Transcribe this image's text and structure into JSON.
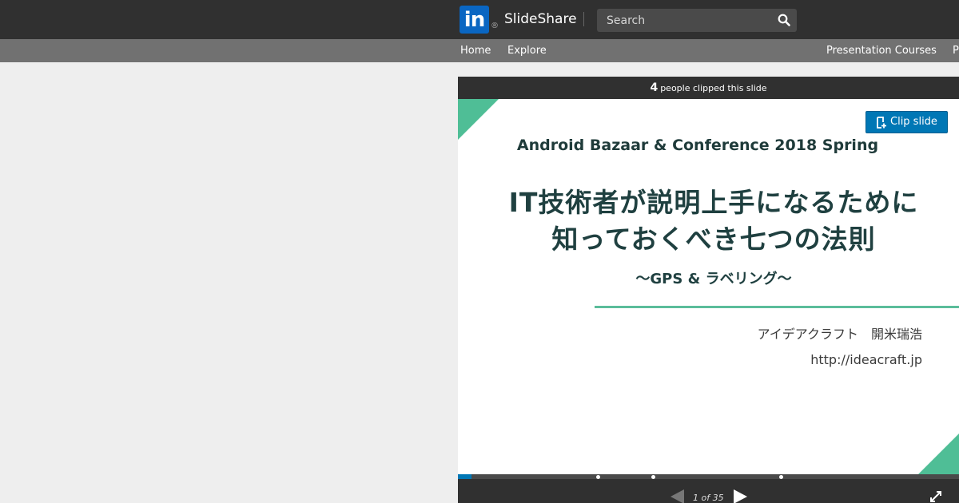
{
  "header": {
    "logo_text": "in",
    "logo_mark": "®",
    "brand": "SlideShare",
    "search_placeholder": "Search",
    "search_icon": "search-icon"
  },
  "nav": {
    "home": "Home",
    "explore": "Explore",
    "courses": "Presentation Courses",
    "truncated": "P"
  },
  "player": {
    "clip_count": "4",
    "clip_text": "people clipped this slide",
    "clip_button": "Clip slide",
    "page_indicator": "1 of 35",
    "progress_fraction": 0.027,
    "progress_markers": [
      0.28,
      0.39,
      0.645
    ]
  },
  "slide": {
    "conference": "Android Bazaar & Conference 2018 Spring",
    "title_line1": "IT技術者が説明上手になるために",
    "title_line2": "知っておくべき七つの法則",
    "subtitle": "〜GPS & ラベリング〜",
    "author": "アイデアクラフト　開米瑞浩",
    "url": "http://ideacraft.jp"
  },
  "colors": {
    "header_bg": "#303030",
    "nav_bg": "#717171",
    "accent_blue": "#0077b5",
    "slide_green": "#4fbe96",
    "title_color": "#1f4040"
  }
}
